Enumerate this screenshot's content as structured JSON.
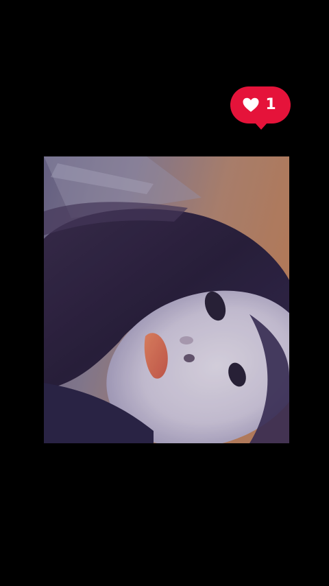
{
  "like_notification": {
    "icon": "heart-icon",
    "count": "1",
    "color": "#e5133a"
  },
  "photo": {
    "subject": "selfie photo",
    "background": "#000000"
  }
}
